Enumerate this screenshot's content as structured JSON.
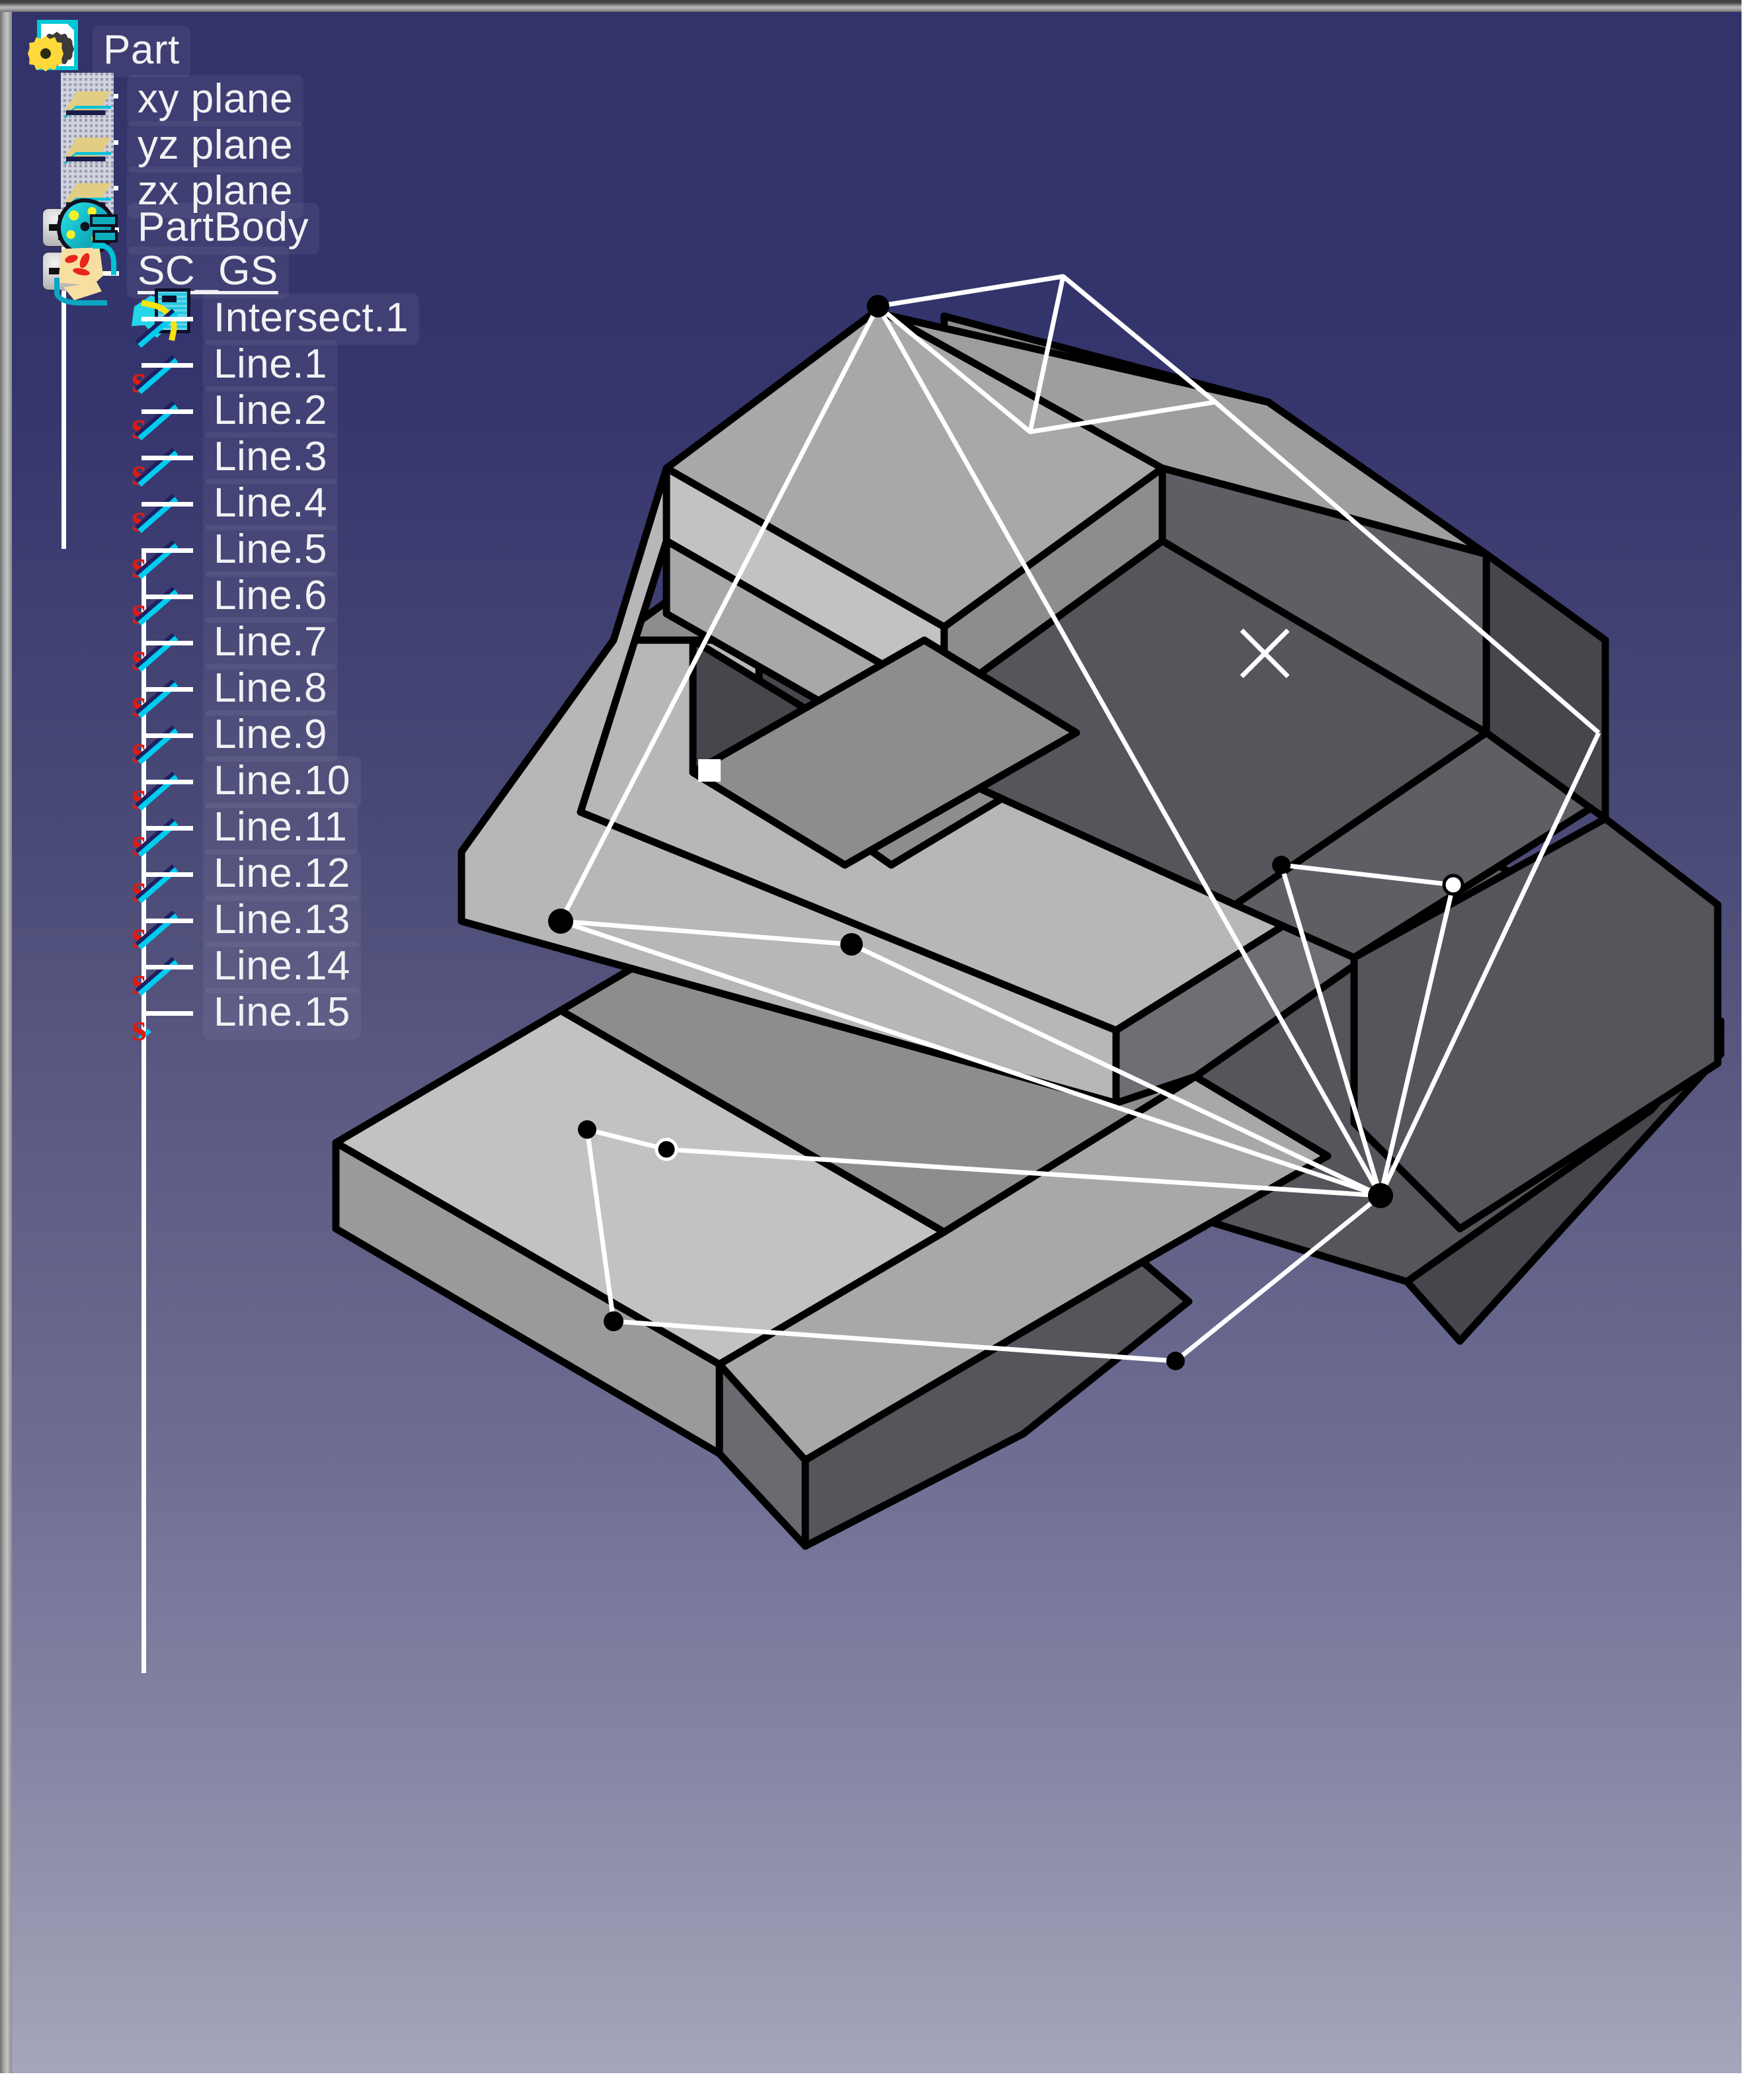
{
  "window": {
    "title": "Part"
  },
  "tree": {
    "root": {
      "label": "Part",
      "icon": "part-document-icon"
    },
    "planes": [
      {
        "label": "xy plane",
        "icon": "plane-icon"
      },
      {
        "label": "yz plane",
        "icon": "plane-icon"
      },
      {
        "label": "zx plane",
        "icon": "plane-icon"
      }
    ],
    "bodies": [
      {
        "label": "PartBody",
        "icon": "partbody-icon",
        "toggle": "+",
        "expanded": false,
        "underlined": false
      },
      {
        "label": "SC_GS",
        "icon": "geometrical-set-icon",
        "toggle": "-",
        "expanded": true,
        "underlined": true
      }
    ],
    "features": [
      {
        "label": "Intersect.1",
        "icon": "intersect-icon"
      },
      {
        "label": "Line.1",
        "icon": "line-icon"
      },
      {
        "label": "Line.2",
        "icon": "line-icon"
      },
      {
        "label": "Line.3",
        "icon": "line-icon"
      },
      {
        "label": "Line.4",
        "icon": "line-icon"
      },
      {
        "label": "Line.5",
        "icon": "line-icon"
      },
      {
        "label": "Line.6",
        "icon": "line-icon"
      },
      {
        "label": "Line.7",
        "icon": "line-icon"
      },
      {
        "label": "Line.8",
        "icon": "line-icon"
      },
      {
        "label": "Line.9",
        "icon": "line-icon"
      },
      {
        "label": "Line.10",
        "icon": "line-icon"
      },
      {
        "label": "Line.11",
        "icon": "line-icon"
      },
      {
        "label": "Line.12",
        "icon": "line-icon"
      },
      {
        "label": "Line.13",
        "icon": "line-icon"
      },
      {
        "label": "Line.14",
        "icon": "line-icon"
      },
      {
        "label": "Line.15",
        "icon": "line-icon"
      }
    ]
  },
  "viewport": {
    "background_top_color": "#33336b",
    "background_bottom_color": "#a4a6bb",
    "model_name": "stepped-pyramid-solid",
    "wireframe_color": "#ffffff",
    "face_colors": {
      "light": "#c2c2c2",
      "medium_light": "#a8a8a8",
      "medium": "#8d8d8d",
      "dark": "#636369",
      "darker": "#55555c",
      "darkest": "#46464d"
    },
    "markers": {
      "point_color": "#000000",
      "selected_point_color": "#ffffff",
      "cross_marker_color": "#ffffff"
    }
  }
}
